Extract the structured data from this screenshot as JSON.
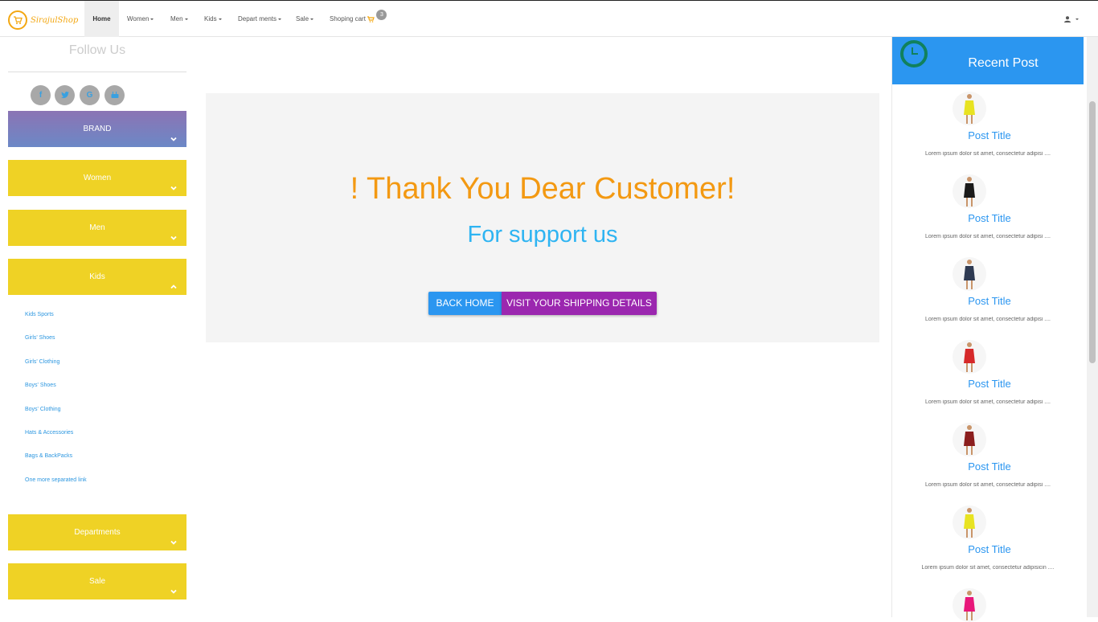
{
  "navbar": {
    "logo_text": "SirajulShop",
    "items": [
      {
        "label": "Home"
      },
      {
        "label": "Women"
      },
      {
        "label": "Men"
      },
      {
        "label": "Kids"
      },
      {
        "label": "Depart ments"
      },
      {
        "label": "Sale"
      },
      {
        "label": "Shoping cart"
      }
    ],
    "cart_count": "3"
  },
  "sidebar": {
    "follow_title": "Follow Us",
    "social": [
      "f",
      "t",
      "G",
      "yt"
    ],
    "categories": [
      {
        "label": "BRAND"
      },
      {
        "label": "Women"
      },
      {
        "label": "Men"
      },
      {
        "label": "Kids"
      },
      {
        "label": "Departments"
      },
      {
        "label": "Sale"
      }
    ],
    "kids_links": [
      "Kids Sports",
      "Girls' Shoes",
      "Girls' Clothing",
      "Boys' Shoes",
      "Boys' Clothing",
      "Hats & Accessories",
      "Bags & BackPacks",
      "One more separated link"
    ]
  },
  "main": {
    "heading": "! Thank You Dear Customer!",
    "subheading": "For support us",
    "back_home": "BACK HOME",
    "shipping": "VISIT YOUR SHIPPING DETAILS"
  },
  "recent": {
    "title": "Recent Post",
    "posts": [
      {
        "title": "Post Title",
        "text": "Lorem ipsum dolor sit amet, consectetur adipisi ....",
        "color": "#e8e322"
      },
      {
        "title": "Post Title",
        "text": "Lorem ipsum dolor sit amet, consectetur adipisi ....",
        "color": "#1a1a1a"
      },
      {
        "title": "Post Title",
        "text": "Lorem ipsum dolor sit amet, consectetur adipisi ....",
        "color": "#2e3a52"
      },
      {
        "title": "Post Title",
        "text": "Lorem ipsum dolor sit amet, consectetur adipisi ....",
        "color": "#d6292a"
      },
      {
        "title": "Post Title",
        "text": "Lorem ipsum dolor sit amet, consectetur adipisi ....",
        "color": "#8b1e1e"
      },
      {
        "title": "Post Title",
        "text": "Lorem ipsum dolor sit amet, consectetur adipisicin ....",
        "color": "#e8e322"
      },
      {
        "title": "",
        "text": "",
        "color": "#e8177a"
      }
    ]
  },
  "colors": {
    "accent_yellow": "#efd225",
    "accent_blue": "#2b96f0",
    "accent_purple": "#9b27af",
    "heading_orange": "#f39912"
  }
}
